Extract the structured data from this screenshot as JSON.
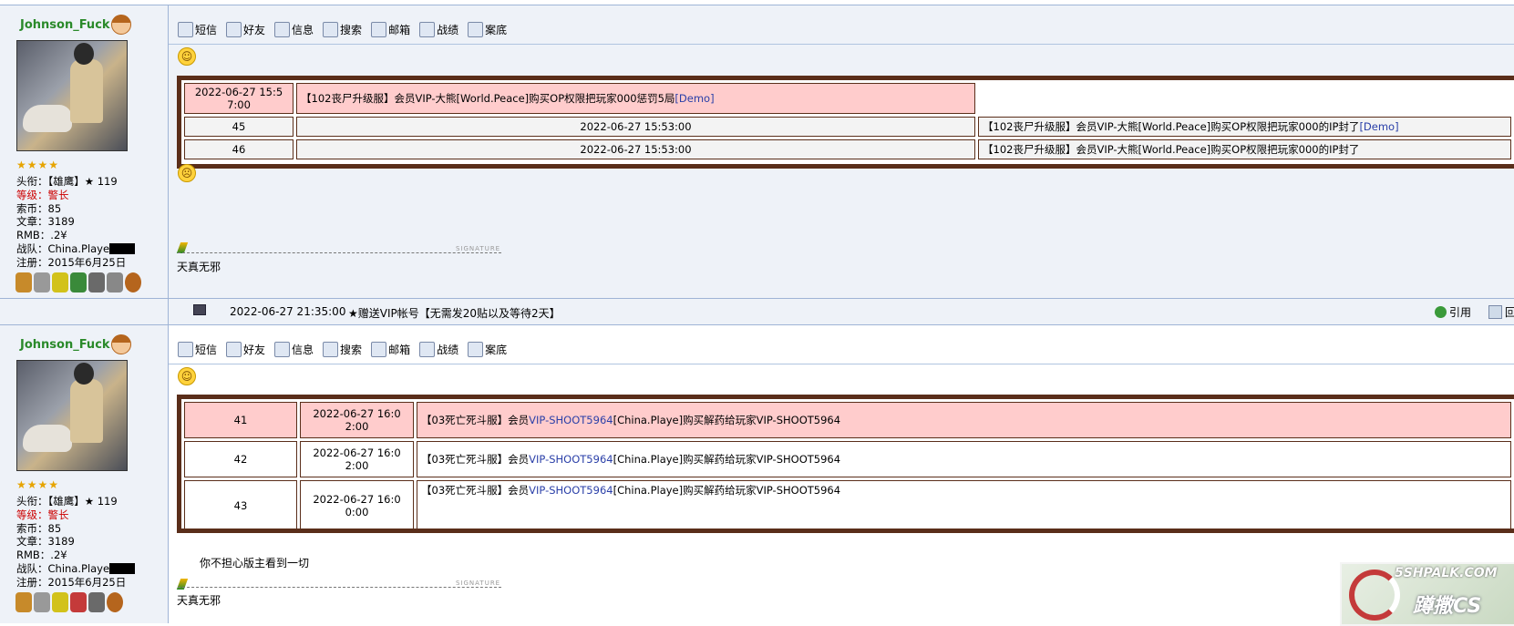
{
  "post1": {
    "username": "Johnson_Fuck",
    "stars": "★★★★",
    "info": {
      "title": "头衔：【雄鹰】★ 119",
      "level": "等级：警长",
      "coins": "索币：85",
      "posts": "文章：3189",
      "rmb": "RMB：.2¥",
      "team": "战队：China.Playe",
      "reg": "注册：2015年6月25日"
    },
    "toolbar": [
      "短信",
      "好友",
      "信息",
      "搜索",
      "邮箱",
      "战绩",
      "案底"
    ],
    "rows": [
      {
        "c1": "2022-06-27 15:5\n7:00",
        "c2": "【102丧尸升级服】会员VIP-大熊[World.Peace]购买OP权限把玩家000惩罚5局",
        "link": "[Demo]"
      },
      {
        "c1": "45",
        "c2": "2022-06-27 15:53:00",
        "c3": "【102丧尸升级服】会员VIP-大熊[World.Peace]购买OP权限把玩家000的IP封了",
        "link": "[Demo]"
      },
      {
        "c1": "46",
        "c2": "2022-06-27 15:53:00",
        "c3": "【102丧尸升级服】会员VIP-大熊[World.Peace]购买OP权限把玩家000的IP封了"
      }
    ],
    "sig_tag": "SIGNATURE",
    "signature": "天真无邪"
  },
  "footer": {
    "time": "2022-06-27 21:35:00",
    "notice": "★赠送VIP帐号【无需发20贴以及等待2天】",
    "quote": "引用",
    "reply": "回"
  },
  "post2": {
    "username": "Johnson_Fuck",
    "stars": "★★★★",
    "info": {
      "title": "头衔：【雄鹰】★ 119",
      "level": "等级：警长",
      "coins": "索币：85",
      "posts": "文章：3189",
      "rmb": "RMB：.2¥",
      "team": "战队：China.Playe",
      "reg": "注册：2015年6月25日"
    },
    "toolbar": [
      "短信",
      "好友",
      "信息",
      "搜索",
      "邮箱",
      "战绩",
      "案底"
    ],
    "rows": [
      {
        "n": "41",
        "t": "2022-06-27 16:0\n2:00",
        "a": "【03死亡死斗服】会员",
        "b": "VIP-SHOOT5964",
        "c": "[China.Playe]购买解药给玩家VIP-SHOOT5964"
      },
      {
        "n": "42",
        "t": "2022-06-27 16:0\n2:00",
        "a": "【03死亡死斗服】会员",
        "b": "VIP-SHOOT5964",
        "c": "[China.Playe]购买解药给玩家VIP-SHOOT5964"
      },
      {
        "n": "43",
        "t": "2022-06-27 16:0\n0:00",
        "a": "【03死亡死斗服】会员",
        "b": "VIP-SHOOT5964",
        "c": "[China.Playe]购买解药给玩家VIP-SHOOT5964"
      }
    ],
    "text": "你不担心版主看到一切",
    "sig_tag": "SIGNATURE",
    "signature": "天真无邪"
  },
  "watermark": {
    "top": "5SHPALK.COM",
    "brand": "蹲撒CS"
  }
}
